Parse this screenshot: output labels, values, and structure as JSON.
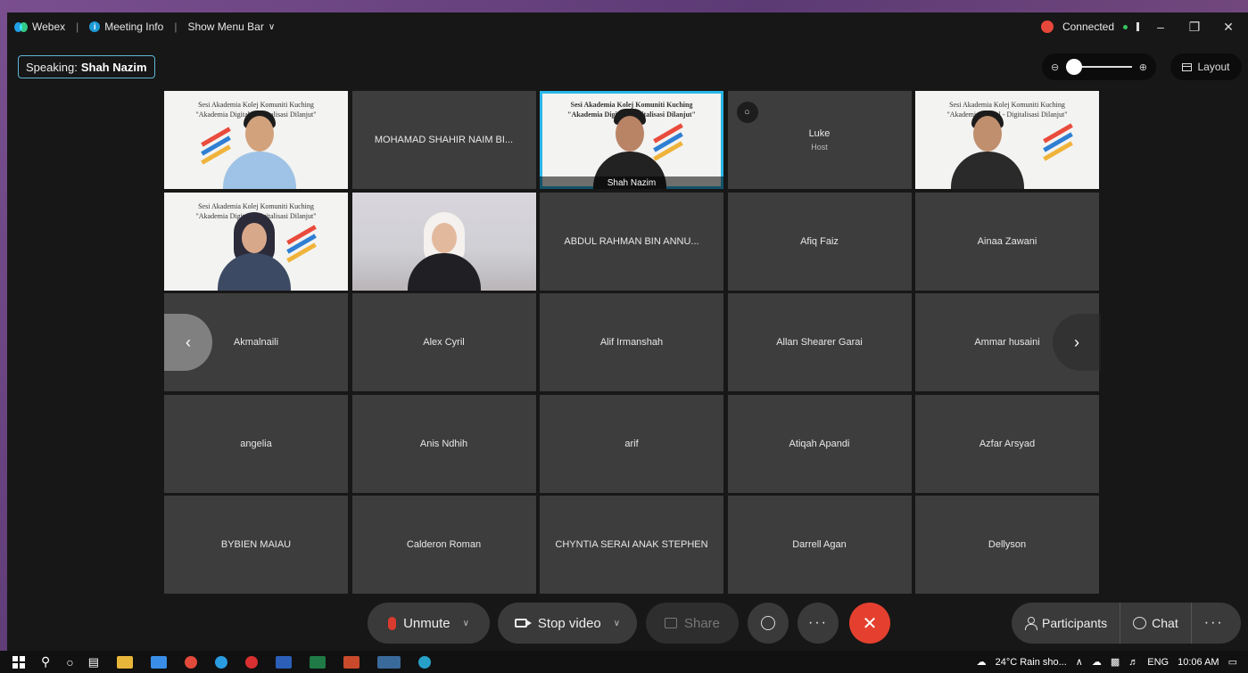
{
  "topbar": {
    "app_name": "Webex",
    "meeting_info": "Meeting Info",
    "show_menu": "Show Menu Bar",
    "status": "Connected"
  },
  "speaking": {
    "label": "Speaking:",
    "name": "Shah Nazim"
  },
  "layout_label": "Layout",
  "tiles": [
    {
      "name": "",
      "type": "video"
    },
    {
      "name": "MOHAMAD SHAHIR NAIM BI...",
      "type": "name"
    },
    {
      "name": "Shah Nazim",
      "type": "video",
      "active": true
    },
    {
      "name": "Luke",
      "sub": "Host",
      "type": "name"
    },
    {
      "name": "",
      "type": "video"
    },
    {
      "name": "",
      "type": "video"
    },
    {
      "name": "",
      "type": "video"
    },
    {
      "name": "ABDUL RAHMAN BIN ANNU...",
      "type": "name"
    },
    {
      "name": "Afiq Faiz",
      "type": "name"
    },
    {
      "name": "Ainaa Zawani",
      "type": "name"
    },
    {
      "name": "Akmalnaili",
      "type": "name"
    },
    {
      "name": "Alex Cyril",
      "type": "name"
    },
    {
      "name": "Alif Irmanshah",
      "type": "name"
    },
    {
      "name": "Allan Shearer Garai",
      "type": "name"
    },
    {
      "name": "Ammar husaini",
      "type": "name"
    },
    {
      "name": "angelia",
      "type": "name"
    },
    {
      "name": "Anis Ndhih",
      "type": "name"
    },
    {
      "name": "arif",
      "type": "name"
    },
    {
      "name": "Atiqah Apandi",
      "type": "name"
    },
    {
      "name": "Azfar Arsyad",
      "type": "name"
    },
    {
      "name": "BYBIEN MAIAU",
      "type": "name"
    },
    {
      "name": "Calderon Roman",
      "type": "name"
    },
    {
      "name": "CHYNTIA SERAI ANAK STEPHEN",
      "type": "name"
    },
    {
      "name": "Darrell Agan",
      "type": "name"
    },
    {
      "name": "Dellyson",
      "type": "name"
    }
  ],
  "slide_text": {
    "line1": "Sesi Akademia Kolej Komuniti Kuching",
    "line2": "\"Akademia Digital - Digitalisasi Dilanjut\""
  },
  "controls": {
    "unmute": "Unmute",
    "stop_video": "Stop video",
    "share": "Share",
    "participants": "Participants",
    "chat": "Chat"
  },
  "taskbar": {
    "weather": "24°C  Rain sho...",
    "lang": "ENG",
    "time": "10:06 AM"
  },
  "colors": {
    "accent": "#29b6e6",
    "end_call": "#e5402f",
    "mute_red": "#d93b2e",
    "tile_bg": "#3d3d3d"
  }
}
